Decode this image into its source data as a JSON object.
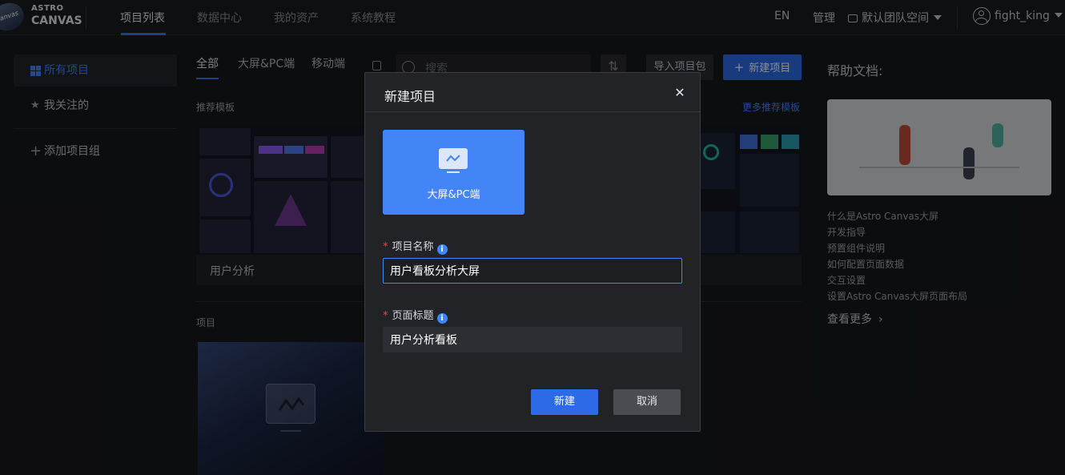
{
  "brand": {
    "line1": "ASTRO",
    "line2": "CANVAS",
    "badge": "Canvas"
  },
  "nav": {
    "items": [
      {
        "label": "项目列表",
        "active": true
      },
      {
        "label": "数据中心",
        "active": false
      },
      {
        "label": "我的资产",
        "active": false
      },
      {
        "label": "系统教程",
        "active": false
      }
    ]
  },
  "topright": {
    "lang": "EN",
    "manage": "管理",
    "team": "默认团队空间",
    "user": "fight_king"
  },
  "sidebar": {
    "items": [
      {
        "label": "所有项目",
        "active": true
      },
      {
        "label": "我关注的",
        "active": false
      },
      {
        "label": "添加项目组",
        "active": false
      }
    ]
  },
  "main": {
    "tabs": [
      {
        "label": "全部",
        "active": true
      },
      {
        "label": "大屏&PC端",
        "active": false
      },
      {
        "label": "移动端",
        "active": false
      }
    ],
    "search_placeholder": "搜索",
    "import_label": "导入项目包",
    "new_label": "新建项目",
    "recommend_label": "推荐模板",
    "more_templates": "更多推荐模板",
    "template_name": "用户分析",
    "projects_label": "项目"
  },
  "help": {
    "title": "帮助文档:",
    "links": [
      "什么是Astro Canvas大屏",
      "开发指导",
      "预置组件说明",
      "如何配置页面数据",
      "交互设置",
      "设置Astro Canvas大屏页面布局"
    ],
    "more": "查看更多"
  },
  "modal": {
    "title": "新建项目",
    "type_label": "大屏&PC端",
    "name_label": "项目名称",
    "name_value": "用户看板分析大屏",
    "page_title_label": "页面标题",
    "page_title_value": "用户分析看板",
    "ok": "新建",
    "cancel": "取消"
  },
  "colors": {
    "accent": "#3477f5",
    "required": "#f5423c",
    "background": "#17181c"
  }
}
